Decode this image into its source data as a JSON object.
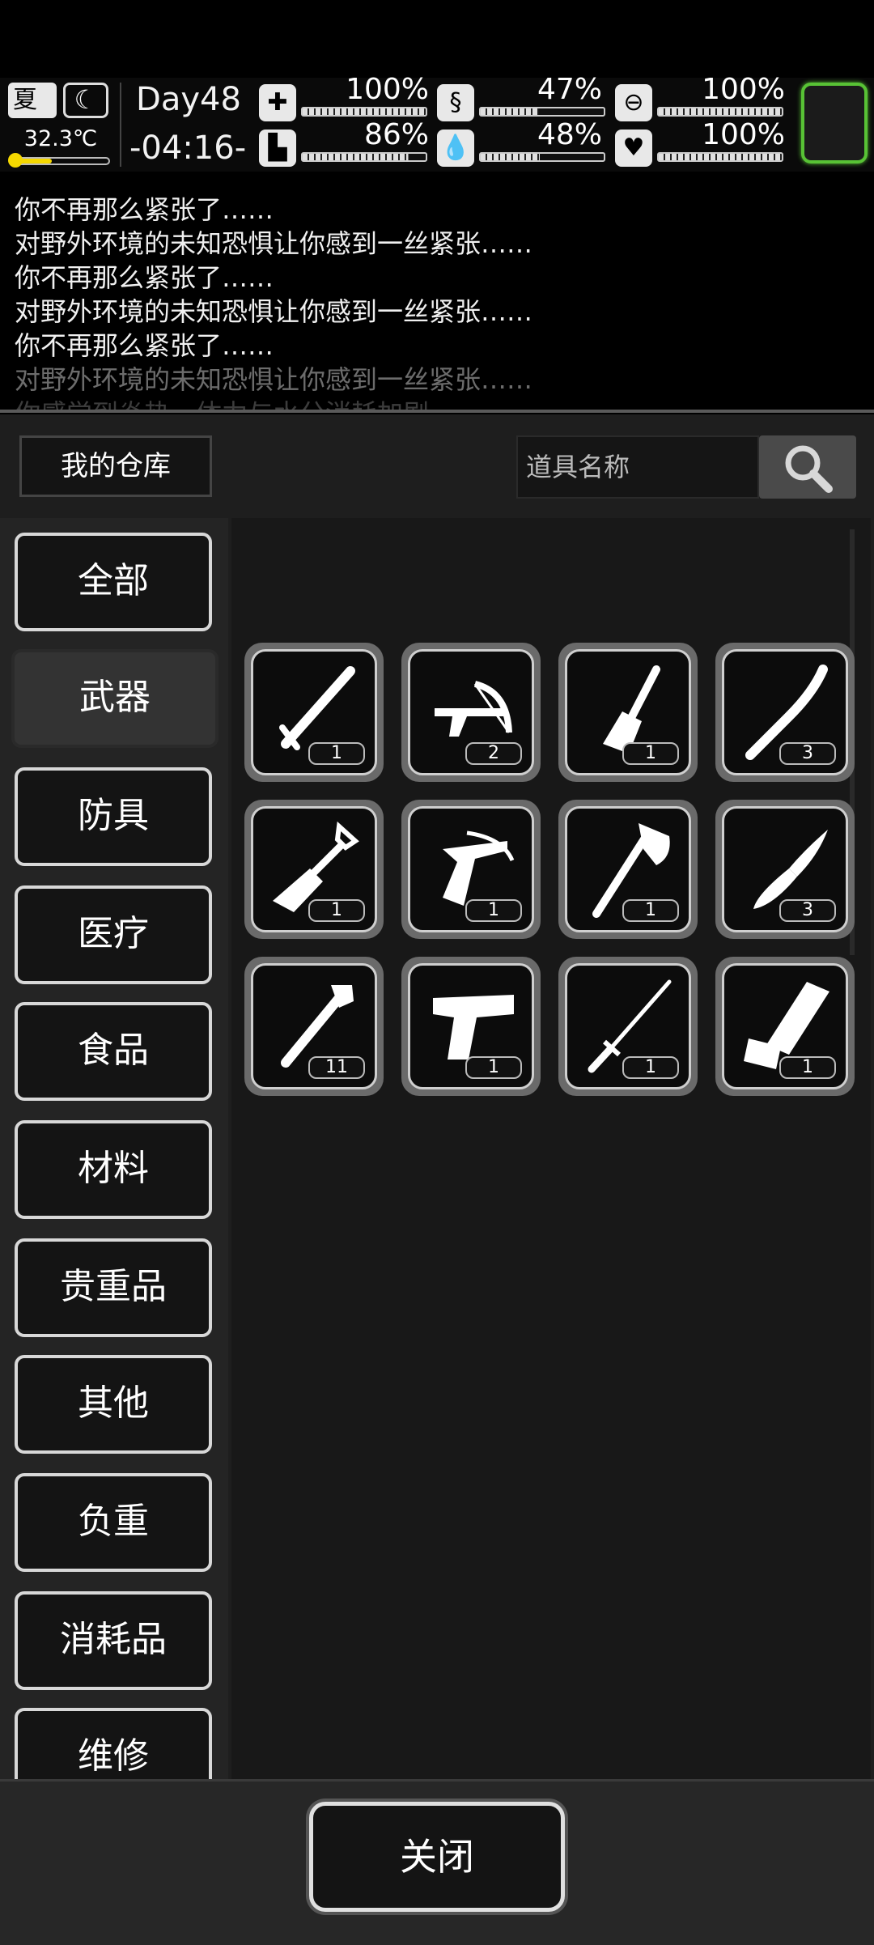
{
  "hud": {
    "season": "夏",
    "temperature": "32.3℃",
    "day": "Day48",
    "time": "-04:16-",
    "stats": [
      {
        "icon": "medkit-icon",
        "value": "100%",
        "fill": 1.0
      },
      {
        "icon": "stomach-icon",
        "value": "47%",
        "fill": 0.47
      },
      {
        "icon": "pill-icon",
        "value": "100%",
        "fill": 1.0
      },
      {
        "icon": "boot-icon",
        "value": "86%",
        "fill": 0.86
      },
      {
        "icon": "water-drop-icon",
        "value": "48%",
        "fill": 0.48
      },
      {
        "icon": "heart-icon",
        "value": "100%",
        "fill": 1.0
      }
    ]
  },
  "log": {
    "lines": [
      "你不再那么紧张了……",
      "对野外环境的未知恐惧让你感到一丝紧张……",
      "你不再那么紧张了……",
      "对野外环境的未知恐惧让你感到一丝紧张……",
      "你不再那么紧张了……",
      "对野外环境的未知恐惧让你感到一丝紧张……",
      "你感觉到炎热，体力与水分消耗加剧"
    ]
  },
  "warehouse": {
    "title": "我的仓库",
    "search_placeholder": "道具名称"
  },
  "categories": [
    "全部",
    "武器",
    "防具",
    "医疗",
    "食品",
    "材料",
    "贵重品",
    "其他",
    "负重",
    "消耗品",
    "维修"
  ],
  "active_category": "武器",
  "items": [
    {
      "name": "baton",
      "count": "1"
    },
    {
      "name": "crossbow",
      "count": "2"
    },
    {
      "name": "chisel",
      "count": "1"
    },
    {
      "name": "wooden-club",
      "count": "3"
    },
    {
      "name": "shovel",
      "count": "1"
    },
    {
      "name": "pistol-crossbow",
      "count": "1"
    },
    {
      "name": "axe",
      "count": "1"
    },
    {
      "name": "knife",
      "count": "3"
    },
    {
      "name": "pipe-wrench",
      "count": "11"
    },
    {
      "name": "pistol",
      "count": "1"
    },
    {
      "name": "sword",
      "count": "1"
    },
    {
      "name": "minigun",
      "count": "1"
    }
  ],
  "close_label": "关闭"
}
